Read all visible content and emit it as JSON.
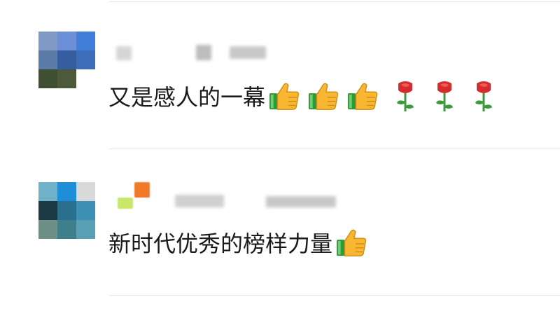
{
  "comments": [
    {
      "text": "又是感人的一幕",
      "emojis": [
        "thumbs-up",
        "thumbs-up",
        "thumbs-up",
        "rose",
        "rose",
        "rose"
      ],
      "avatar_colors": [
        "#7f98c4",
        "#6c8fd8",
        "#3f7fd9",
        "#5b7ba8",
        "#345ea0",
        "#3d6cb8",
        "#3f5032",
        "#4c5a3b",
        "#ffffff"
      ]
    },
    {
      "text": "新时代优秀的榜样力量",
      "emojis": [
        "thumbs-up"
      ],
      "avatar_colors": [
        "#6fb1c9",
        "#1f8ed9",
        "#d9d9d9",
        "#1d3a44",
        "#2b6f8f",
        "#3d8fb3",
        "#6d8f86",
        "#3e7f8b",
        "#5aa0b5"
      ]
    }
  ],
  "colors": {
    "text": "#1a1a1a",
    "divider": "#e6e6e6",
    "thumb_yellow": "#f7b733",
    "thumb_cuff": "#2f9a3a",
    "rose_red": "#d62b2b",
    "stem_green": "#3c9a3c"
  }
}
